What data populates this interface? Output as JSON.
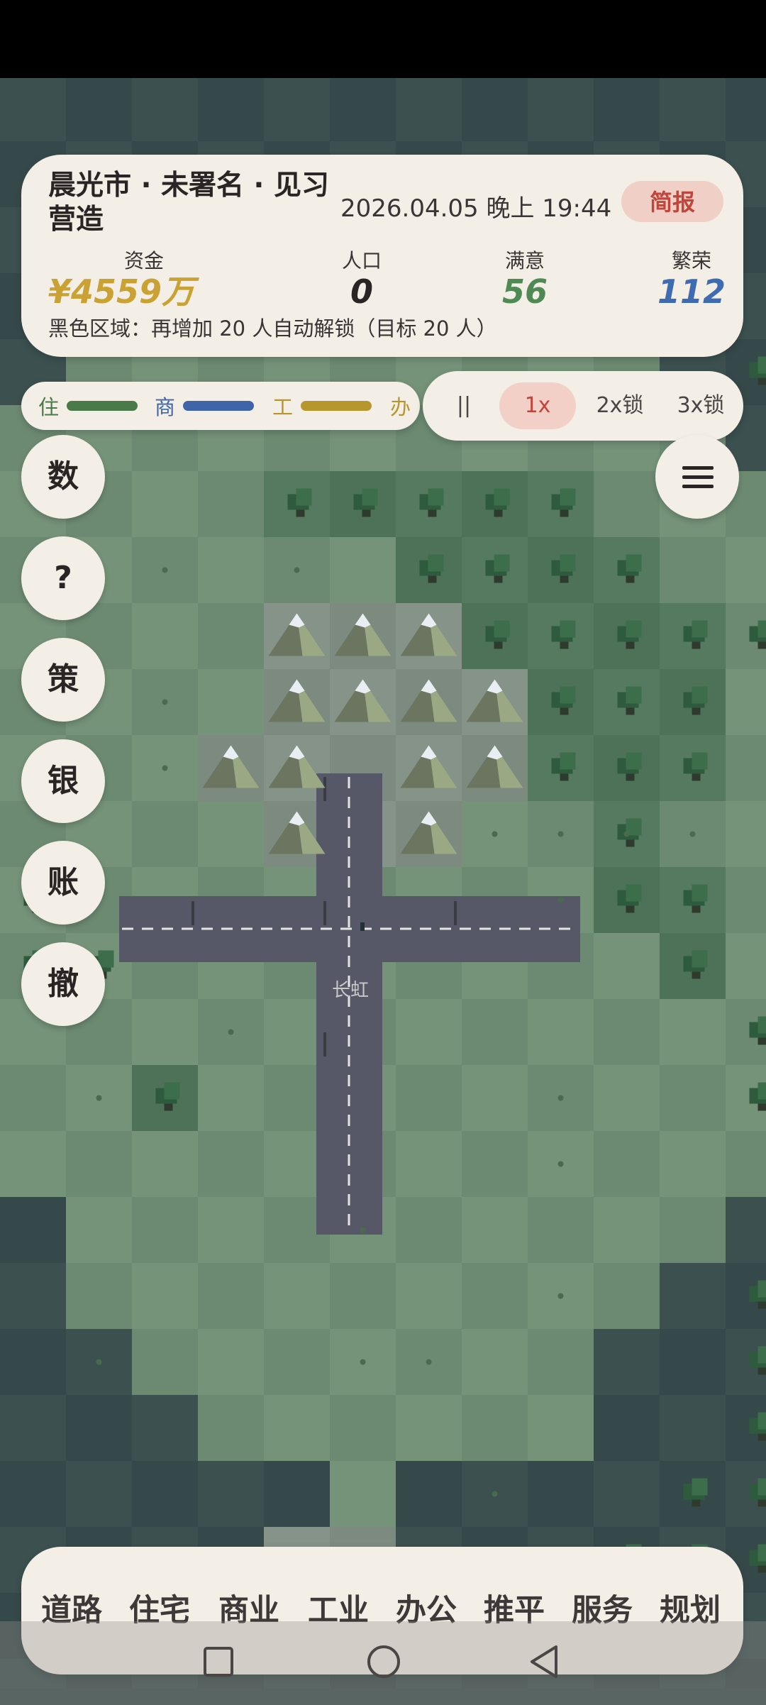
{
  "hud": {
    "city_title": "晨光市 · 未署名 · 见习营造",
    "datetime": "2026.04.05 晚上 19:44",
    "brief_label": "简报",
    "stats": [
      {
        "label": "资金",
        "value": "¥4559万",
        "color": "#c9a233"
      },
      {
        "label": "人口",
        "value": "0",
        "color": "#2a2424"
      },
      {
        "label": "满意",
        "value": "56",
        "color": "#4f8a55"
      },
      {
        "label": "繁荣",
        "value": "112",
        "color": "#3f6bb0"
      }
    ],
    "unlock_text": "黑色区域：再增加 20 人自动解锁（目标 20 人）"
  },
  "demand": {
    "items": [
      {
        "label": "住",
        "color": "#4a7a4a",
        "level": 1.0
      },
      {
        "label": "商",
        "color": "#3f65a8",
        "level": 1.0
      },
      {
        "label": "工",
        "color": "#b8962e",
        "level": 1.0
      },
      {
        "label": "办",
        "color": "#b8962e",
        "level": 0.0
      }
    ]
  },
  "speed": {
    "pause": "||",
    "options": [
      "1x",
      "2x锁",
      "3x锁"
    ],
    "active": "1x"
  },
  "side_buttons": [
    "数",
    "?",
    "策",
    "银",
    "账",
    "撤"
  ],
  "map": {
    "road_label": "长虹"
  },
  "toolbar": {
    "tools": [
      "道路",
      "住宅",
      "商业",
      "工业",
      "办公",
      "推平",
      "服务",
      "规划"
    ]
  }
}
